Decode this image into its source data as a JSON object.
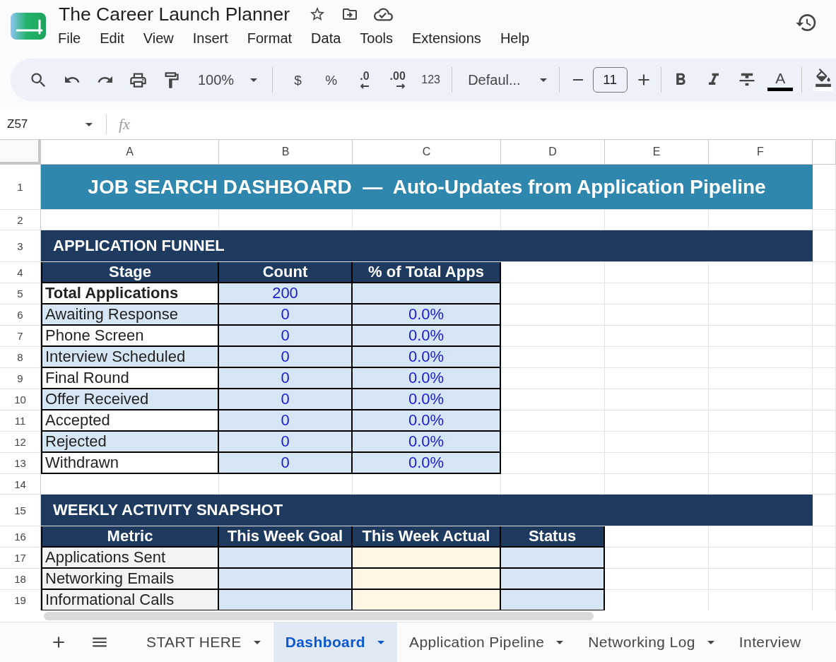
{
  "document": {
    "title": "The Career Launch Planner",
    "menu": [
      "File",
      "Edit",
      "View",
      "Insert",
      "Format",
      "Data",
      "Tools",
      "Extensions",
      "Help"
    ]
  },
  "toolbar": {
    "zoom": "100%",
    "currency": "$",
    "percent": "%",
    "decrease_decimals": ".0",
    "increase_decimals": ".00",
    "number_format": "123",
    "font": "Defaul...",
    "font_size": "11",
    "text_color": "A"
  },
  "formula_bar": {
    "cell_ref": "Z57",
    "function_symbol": "fx"
  },
  "sheet": {
    "columns": [
      "A",
      "B",
      "C",
      "D",
      "E",
      "F"
    ],
    "rows": [
      {
        "number": "1",
        "kind": "title",
        "text": "JOB SEARCH DASHBOARD  —  Auto-Updates from Application Pipeline"
      },
      {
        "number": "2",
        "kind": "blank"
      },
      {
        "number": "3",
        "kind": "section",
        "text": "APPLICATION FUNNEL"
      },
      {
        "number": "4",
        "kind": "header",
        "cells": [
          "Stage",
          "Count",
          "% of Total Apps"
        ]
      },
      {
        "number": "5",
        "kind": "total",
        "cells": [
          "Total Applications",
          "200"
        ]
      },
      {
        "number": "6",
        "kind": "stage",
        "cells": [
          "Awaiting Response",
          "0",
          "0.0%"
        ]
      },
      {
        "number": "7",
        "kind": "stage",
        "cells": [
          "Phone Screen",
          "0",
          "0.0%"
        ]
      },
      {
        "number": "8",
        "kind": "stage",
        "cells": [
          "Interview Scheduled",
          "0",
          "0.0%"
        ]
      },
      {
        "number": "9",
        "kind": "stage",
        "cells": [
          "Final Round",
          "0",
          "0.0%"
        ]
      },
      {
        "number": "10",
        "kind": "stage",
        "cells": [
          "Offer Received",
          "0",
          "0.0%"
        ]
      },
      {
        "number": "11",
        "kind": "stage",
        "cells": [
          "Accepted",
          "0",
          "0.0%"
        ]
      },
      {
        "number": "12",
        "kind": "stage",
        "cells": [
          "Rejected",
          "0",
          "0.0%"
        ]
      },
      {
        "number": "13",
        "kind": "stage",
        "cells": [
          "Withdrawn",
          "0",
          "0.0%"
        ]
      },
      {
        "number": "14",
        "kind": "blank"
      },
      {
        "number": "15",
        "kind": "section",
        "text": "WEEKLY ACTIVITY SNAPSHOT"
      },
      {
        "number": "16",
        "kind": "header",
        "cells": [
          "Metric",
          "This Week Goal",
          "This Week Actual",
          "Status"
        ]
      },
      {
        "number": "17",
        "kind": "metric",
        "cells": [
          "Applications Sent"
        ]
      },
      {
        "number": "18",
        "kind": "metric",
        "cells": [
          "Networking Emails"
        ]
      },
      {
        "number": "19",
        "kind": "metric",
        "cells": [
          "Informational Calls"
        ]
      }
    ]
  },
  "sheet_tabs": [
    {
      "label": "START HERE",
      "selected": false,
      "dropdown": true
    },
    {
      "label": "Dashboard",
      "selected": true,
      "dropdown": true
    },
    {
      "label": "Application Pipeline",
      "selected": false,
      "dropdown": true
    },
    {
      "label": "Networking Log",
      "selected": false,
      "dropdown": true
    },
    {
      "label": "Interview",
      "selected": false,
      "dropdown": false
    }
  ]
}
